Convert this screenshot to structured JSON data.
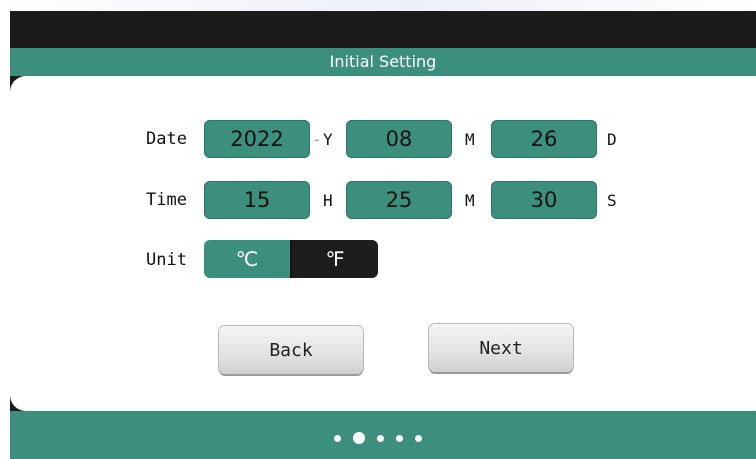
{
  "header": {
    "title": "Initial Setting"
  },
  "date_row": {
    "label": "Date",
    "year": {
      "value": "2022",
      "suffix": "Y"
    },
    "month": {
      "value": "08",
      "suffix": "M"
    },
    "day": {
      "value": "26",
      "suffix": "D"
    }
  },
  "time_row": {
    "label": "Time",
    "hour": {
      "value": "15",
      "suffix": "H"
    },
    "minute": {
      "value": "25",
      "suffix": "M"
    },
    "second": {
      "value": "30",
      "suffix": "S"
    }
  },
  "unit_row": {
    "label": "Unit",
    "celsius": "℃",
    "fahrenheit": "℉",
    "selected": "celsius"
  },
  "buttons": {
    "back": "Back",
    "next": "Next"
  },
  "pager": {
    "total": 5,
    "current": 2
  },
  "colors": {
    "accent": "#3b8f7c",
    "frame": "#1b1b1b",
    "toggle_off": "#1d1d1d"
  }
}
